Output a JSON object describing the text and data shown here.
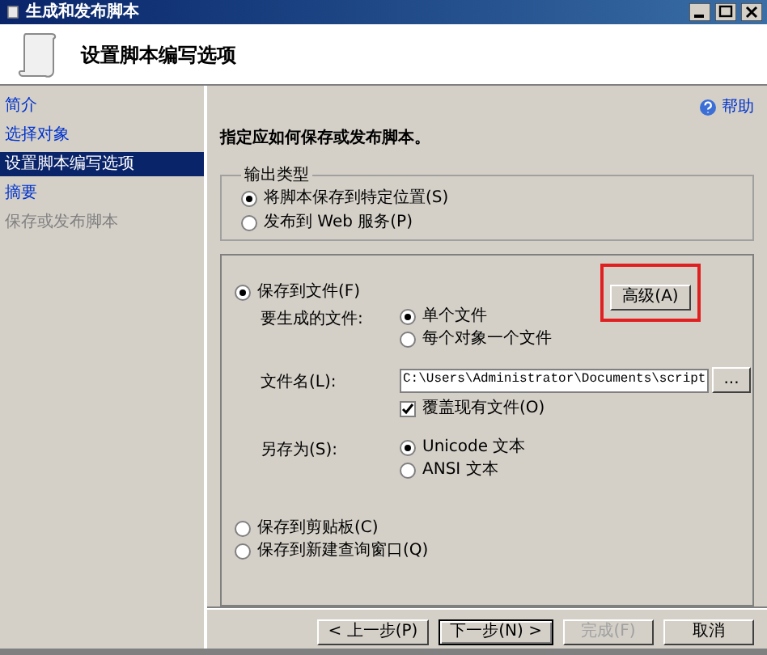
{
  "window": {
    "title": "生成和发布脚本"
  },
  "header": {
    "title": "设置脚本编写选项"
  },
  "sidebar": {
    "items": [
      {
        "label": "简介",
        "selected": false,
        "disabled": false
      },
      {
        "label": "选择对象",
        "selected": false,
        "disabled": false
      },
      {
        "label": "设置脚本编写选项",
        "selected": true,
        "disabled": false
      },
      {
        "label": "摘要",
        "selected": false,
        "disabled": false
      },
      {
        "label": "保存或发布脚本",
        "selected": false,
        "disabled": true
      }
    ]
  },
  "help": "帮助",
  "instruction": "指定应如何保存或发布脚本。",
  "output_type": {
    "legend": "输出类型",
    "options": [
      {
        "label": "将脚本保存到特定位置(S)",
        "selected": true
      },
      {
        "label": "发布到 Web 服务(P)",
        "selected": false
      }
    ]
  },
  "save_to_file": {
    "label": "保存到文件(F)",
    "selected": true,
    "advanced_button": {
      "label": "高级(A)",
      "highlighted": true
    },
    "files_label": "要生成的文件:",
    "files_options": [
      {
        "label": "单个文件",
        "selected": true
      },
      {
        "label": "每个对象一个文件",
        "selected": false
      }
    ],
    "filename_label": "文件名(L):",
    "filename_value": "C:\\Users\\Administrator\\Documents\\script",
    "browse": "...",
    "overwrite": {
      "label": "覆盖现有文件(O)",
      "checked": true
    },
    "save_as_label": "另存为(S):",
    "save_as_options": [
      {
        "label": "Unicode 文本",
        "selected": true
      },
      {
        "label": "ANSI 文本",
        "selected": false
      }
    ]
  },
  "other_destinations": [
    {
      "label": "保存到剪贴板(C)",
      "selected": false
    },
    {
      "label": "保存到新建查询窗口(Q)",
      "selected": false
    }
  ],
  "buttons": [
    {
      "label": "< 上一步(P)",
      "disabled": false,
      "default": false
    },
    {
      "label": "下一步(N) >",
      "disabled": false,
      "default": true
    },
    {
      "label": "完成(F)",
      "disabled": true,
      "default": false
    },
    {
      "label": "取消",
      "disabled": false,
      "default": false
    }
  ]
}
